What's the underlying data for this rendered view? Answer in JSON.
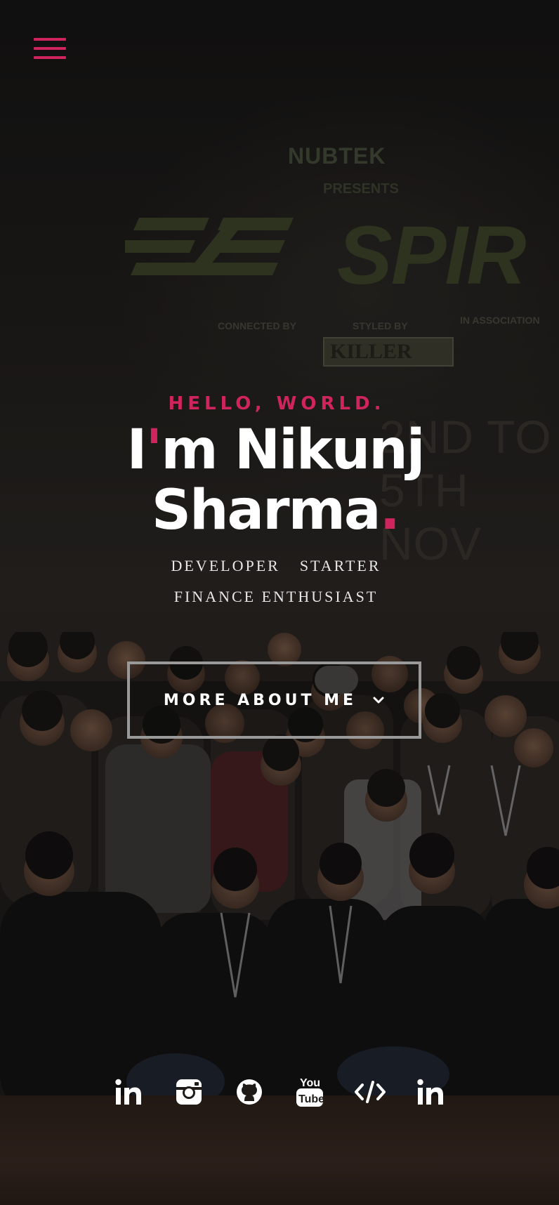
{
  "nav": {
    "menu_icon": "hamburger-menu-icon"
  },
  "background": {
    "banner": {
      "brand": "NUBTEK",
      "presents": "PRESENTS",
      "event": "SPIR",
      "connected_by": "CONNECTED BY",
      "styled_by": "STYLED BY",
      "in_association": "IN ASSOCIATION",
      "sponsor": "KILLER",
      "date": "2ND TO 5TH NOV"
    }
  },
  "hero": {
    "greeting": "HELLO, WORLD.",
    "name_line1_prefix": "I",
    "name_line1_apostrophe": "'",
    "name_line1_rest": "m Nikunj",
    "name_line2": "Sharma",
    "name_dot": ".",
    "roles_line1_a": "DEVELOPER",
    "roles_line1_b": "STARTER",
    "roles_line2": "FINANCE ENTHUSIAST",
    "cta_label": "MORE ABOUT ME",
    "cta_icon": "chevron-down-icon"
  },
  "socials": [
    {
      "name": "linkedin-icon"
    },
    {
      "name": "instagram-icon"
    },
    {
      "name": "github-icon"
    },
    {
      "name": "youtube-icon"
    },
    {
      "name": "code-icon"
    },
    {
      "name": "linkedin-icon"
    }
  ],
  "colors": {
    "accent": "#d0245f",
    "text": "#ffffff",
    "button_border": "#9a9a9a"
  }
}
